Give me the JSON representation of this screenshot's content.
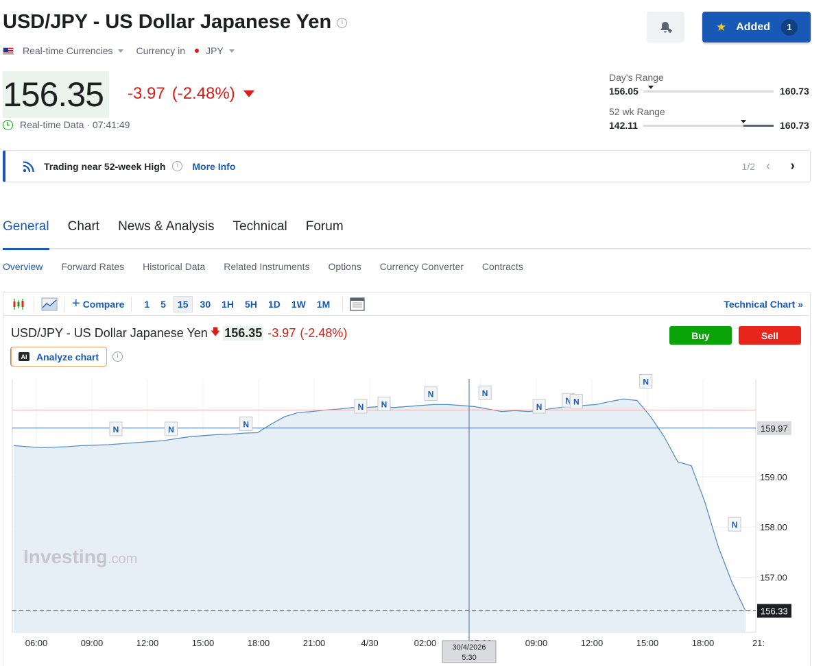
{
  "header": {
    "title": "USD/JPY - US Dollar Japanese Yen",
    "market_type": "Real-time Currencies",
    "currency_in_label": "Currency in",
    "currency": "JPY",
    "added_label": "Added",
    "added_count": "1"
  },
  "quote": {
    "price": "156.35",
    "change": "-3.97",
    "change_pct": "(-2.48%)",
    "data_label": "Real-time Data",
    "time": "· 07:41:49"
  },
  "ranges": {
    "day": {
      "label": "Day's Range",
      "low": "156.05",
      "high": "160.73",
      "marker_frac": 0.06
    },
    "week52": {
      "label": "52 wk Range",
      "low": "142.11",
      "high": "160.73",
      "marker_frac": 0.77
    }
  },
  "banner": {
    "text": "Trading near 52-week High",
    "more": "More Info",
    "pager": "1/2"
  },
  "tabs": [
    "General",
    "Chart",
    "News & Analysis",
    "Technical",
    "Forum"
  ],
  "subtabs": [
    "Overview",
    "Forward Rates",
    "Historical Data",
    "Related Instruments",
    "Options",
    "Currency Converter",
    "Contracts"
  ],
  "toolbar": {
    "compare": "Compare",
    "periods": [
      "1",
      "5",
      "15",
      "30",
      "1H",
      "5H",
      "1D",
      "1W",
      "1M"
    ],
    "active_period": "15",
    "technical_chart": "Technical Chart »"
  },
  "chart_header": {
    "name": "USD/JPY - US Dollar Japanese Yen",
    "price": "156.35",
    "change": "-3.97",
    "change_pct": "(-2.48%)",
    "buy": "Buy",
    "sell": "Sell",
    "analyze": "Analyze chart",
    "ai": "AI"
  },
  "watermark": {
    "brand": "Investing",
    "suffix": ".com"
  },
  "colors": {
    "accent": "#1759b4",
    "down": "#d91e18",
    "up": "#0aa308",
    "line": "#5a8fc4",
    "area": "#e6eef6"
  },
  "chart_data": {
    "type": "area",
    "ylim": [
      155.9,
      160.95
    ],
    "y_ticks": [
      157.0,
      158.0,
      159.0
    ],
    "x_ticks": [
      "06:00",
      "09:00",
      "12:00",
      "15:00",
      "18:00",
      "21:00",
      "4/30",
      "02:00",
      "05:30",
      "09:00",
      "12:00",
      "15:00",
      "18:00",
      "21:"
    ],
    "price_labels": {
      "previous_close": "159.97",
      "last": "156.33"
    },
    "crosshair_label": [
      "30/4/2026",
      "5:30"
    ],
    "series": [
      {
        "values": [
          159.62,
          159.6,
          159.58,
          159.59,
          159.6,
          159.62,
          159.63,
          159.64,
          159.66,
          159.68,
          159.7,
          159.72,
          159.76,
          159.8,
          159.82,
          159.84,
          159.85,
          159.87,
          159.88,
          160.05,
          160.2,
          160.28,
          160.3,
          160.33,
          160.35,
          160.38,
          160.38,
          160.4,
          160.38,
          160.4,
          160.42,
          160.44,
          160.44,
          160.42,
          160.4,
          160.35,
          160.3,
          160.32,
          160.3,
          160.33,
          160.37,
          160.4,
          160.42,
          160.44,
          160.5,
          160.55,
          160.52,
          160.2,
          159.8,
          159.3,
          159.22,
          158.5,
          157.6,
          156.9,
          156.33
        ]
      }
    ]
  },
  "news_markers": [
    {
      "label": "N",
      "x": 0.195,
      "y": 159.9
    },
    {
      "label": "N",
      "x": 0.299,
      "y": 159.9
    },
    {
      "label": "N",
      "x": 0.44,
      "y": 160.0
    },
    {
      "label": "N",
      "x": 0.656,
      "y": 160.35
    },
    {
      "label": "N",
      "x": 0.7,
      "y": 160.4
    },
    {
      "label": "N",
      "x": 0.788,
      "y": 160.6
    },
    {
      "label": "N",
      "x": 0.89,
      "y": 160.62
    },
    {
      "label": "N",
      "x": 0.992,
      "y": 160.35
    },
    {
      "label": "N",
      "x": 1.047,
      "y": 160.47
    },
    {
      "label": "N",
      "x": 1.062,
      "y": 160.45
    },
    {
      "label": "N",
      "x": 1.193,
      "y": 160.85
    },
    {
      "label": "N",
      "x": 1.36,
      "y": 158.0
    }
  ]
}
